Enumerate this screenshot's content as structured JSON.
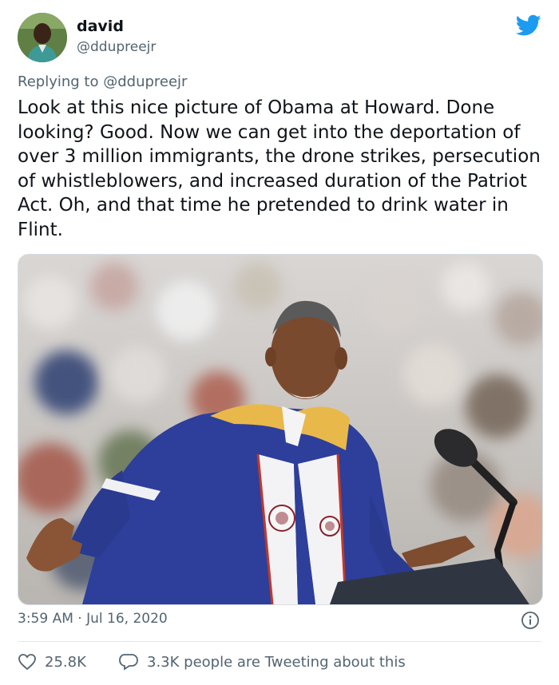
{
  "author": {
    "name": "david",
    "handle": "@ddupreejr",
    "avatar_icon": "user-avatar"
  },
  "platform_icon": "twitter-bird-icon",
  "brand_color": "#1d9bf0",
  "reply": {
    "prefix": "Replying to",
    "mention": "@ddupreejr"
  },
  "tweet_text": "Look at this nice picture of Obama at Howard. Done looking? Good. Now we can get into the deportation of over 3 million immigrants, the drone strikes, persecution of whistleblowers, and increased duration of the Patriot Act. Oh, and that time he pretended to drink water in Flint.",
  "media": {
    "icon": "tweet-photo"
  },
  "timestamp": "3:59 AM · Jul 16, 2020",
  "stats": {
    "likes": "25.8K",
    "conversation": "3.3K people are Tweeting about this"
  }
}
